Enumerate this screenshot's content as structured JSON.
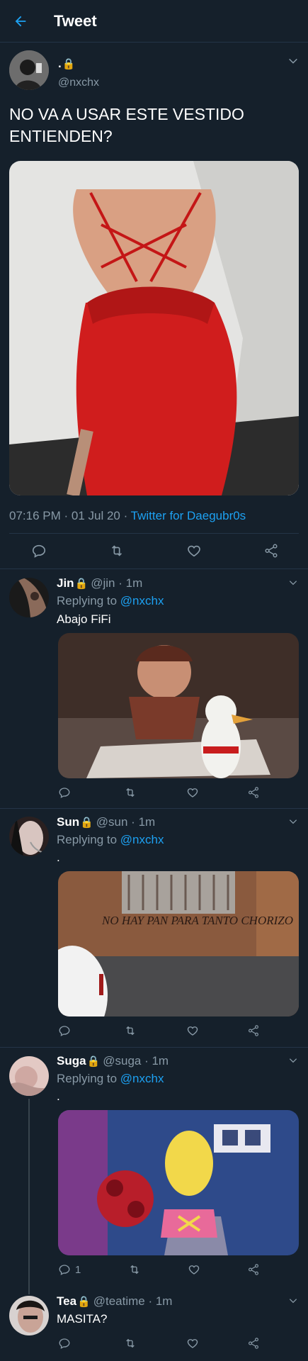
{
  "header": {
    "title": "Tweet"
  },
  "main_tweet": {
    "display_name": ".",
    "handle": "@nxchx",
    "text_line1": "NO VA A USAR ESTE VESTIDO",
    "text_line2": "ENTIENDEN?",
    "time": "07:16 PM · 01 Jul 20 · ",
    "source": "Twitter for Daegubr0s"
  },
  "replies": [
    {
      "name": "Jin",
      "meta": "@jin · 1m",
      "replying": "Replying to ",
      "reply_handle": "@nxchx",
      "text": "Abajo FiFi",
      "reply_count": ""
    },
    {
      "name": "Sun",
      "meta": "@sun · 1m",
      "replying": "Replying to ",
      "reply_handle": "@nxchx",
      "text": ".",
      "reply_count": ""
    },
    {
      "name": "Suga",
      "meta": "@suga · 1m",
      "replying": "Replying to ",
      "reply_handle": "@nxchx",
      "text": ".",
      "reply_count": "1"
    },
    {
      "name": "Tea",
      "meta": "@teatime · 1m",
      "text": "MASITA?",
      "reply_count": ""
    }
  ],
  "images": {
    "reply1": "NO HAY PAN PARA TANTO CHORIZO"
  },
  "colors": {
    "background": "#15202b",
    "accent": "#1da1f2",
    "muted": "#8899a6",
    "divider": "#243447",
    "lock": "#f5c518"
  }
}
